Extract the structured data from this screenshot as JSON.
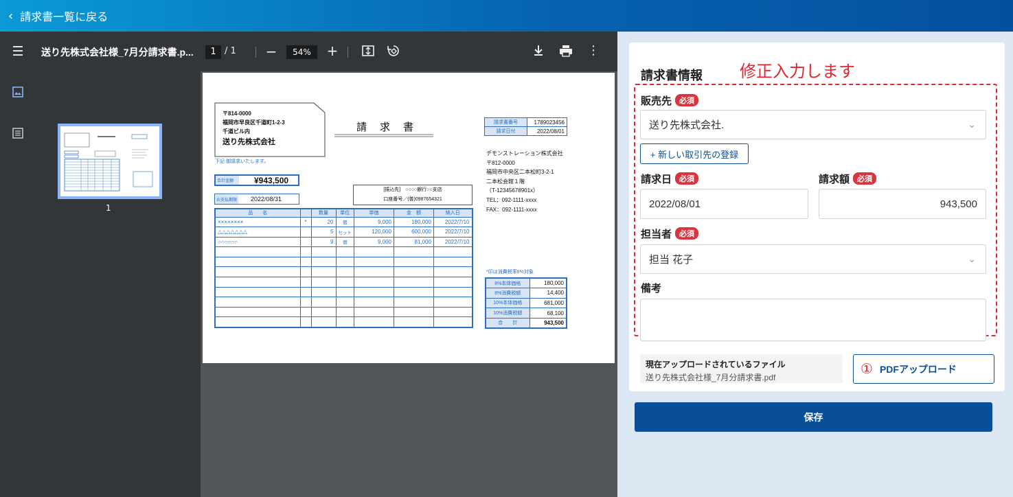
{
  "header": {
    "back_label": "請求書一覧に戻る"
  },
  "viewer": {
    "file_name": "送り先株式会社様_7月分請求書.p...",
    "page_current": "1",
    "page_total": "/ 1",
    "zoom": "54%",
    "thumb_page": "1"
  },
  "invoice": {
    "postal": "〒814-0000",
    "addr1": "福岡市早良区千道町1-2-3",
    "addr2": "千道ビル内",
    "to": "送り先株式会社",
    "note": "下記 御請求いたします。",
    "title": "請　求　書",
    "meta": [
      {
        "k": "請求書番号",
        "v": "1789023456"
      },
      {
        "k": "請求日付",
        "v": "2022/08/01"
      }
    ],
    "total_label": "合計金額",
    "total": "¥943,500",
    "due_label": "お支払期限",
    "due": "2022/08/31",
    "bank1": "[振込先]　○○○○銀行○○支店",
    "bank2": "口座番号／(普)0987654321",
    "issuer": [
      "デモンストレーション株式会社",
      "〒812-0000",
      "福岡市中央区二本松町3-2-1",
      "二本松会館１階",
      "（T-12345678901x）",
      "TEL：092-1111-xxxx",
      "FAX：092-1111-xxxx"
    ],
    "headers": [
      "品　　名",
      "",
      "数量",
      "単位",
      "単価",
      "金　額",
      "納入日"
    ],
    "rows": [
      [
        "××××××××",
        "*",
        "20",
        "個",
        "9,000",
        "180,000",
        "2022/7/10"
      ],
      [
        "△△△△△△△",
        "",
        "5",
        "セット",
        "120,000",
        "600,000",
        "2022/7/10"
      ],
      [
        "○○○○○○",
        "",
        "9",
        "個",
        "9,000",
        "81,000",
        "2022/7/10"
      ],
      [
        "",
        "",
        "",
        "",
        "",
        "",
        ""
      ],
      [
        "",
        "",
        "",
        "",
        "",
        "",
        ""
      ],
      [
        "",
        "",
        "",
        "",
        "",
        "",
        ""
      ],
      [
        "",
        "",
        "",
        "",
        "",
        "",
        ""
      ],
      [
        "",
        "",
        "",
        "",
        "",
        "",
        ""
      ],
      [
        "",
        "",
        "",
        "",
        "",
        "",
        ""
      ],
      [
        "",
        "",
        "",
        "",
        "",
        "",
        ""
      ],
      [
        "",
        "",
        "",
        "",
        "",
        "",
        ""
      ]
    ],
    "tax_note": "*印は消費税率8%対象",
    "summary": [
      {
        "k": "8%本体価格",
        "v": "180,000"
      },
      {
        "k": "8%消費税額",
        "v": "14,400"
      },
      {
        "k": "10%本体価格",
        "v": "681,000"
      },
      {
        "k": "10%消費税額",
        "v": "68,100"
      },
      {
        "k": "合　　計",
        "v": "943,500"
      }
    ]
  },
  "form": {
    "title": "請求書情報",
    "annotation": "修正入力します",
    "required": "必須",
    "vendor_label": "販売先",
    "vendor_value": "送り先株式会社.",
    "new_partner_button": "+ 新しい取引先の登録",
    "date_label": "請求日",
    "date_value": "2022/08/01",
    "amount_label": "請求額",
    "amount_value": "943,500",
    "person_label": "担当者",
    "person_value": "担当 花子",
    "memo_label": "備考",
    "memo_value": "",
    "upload_current_label": "現在アップロードされているファイル",
    "upload_current_file": "送り先株式会社様_7月分請求書.pdf",
    "upload_marker": "①",
    "upload_button": "PDFアップロード",
    "save_button": "保存"
  },
  "colors": {
    "accent": "#0a4f96",
    "required": "#d9343f",
    "annotation": "#e0262f",
    "invoice_blue": "#2a6fc0"
  }
}
